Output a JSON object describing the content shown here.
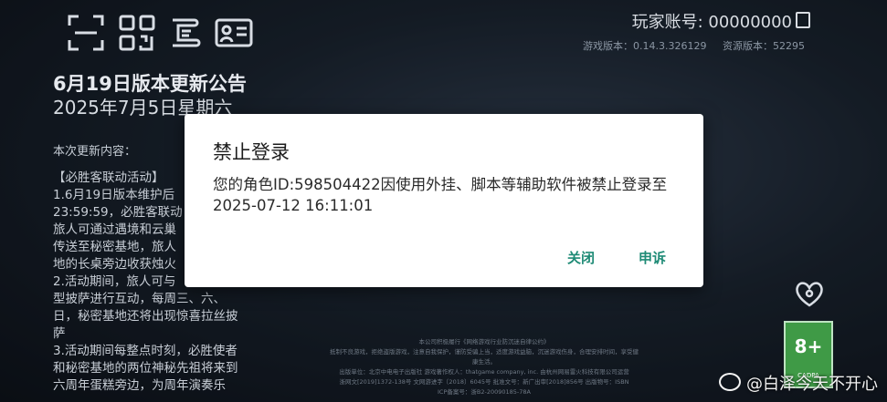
{
  "account": {
    "label": "玩家账号: 00000000"
  },
  "versions": {
    "game": "游戏版本：0.14.3.326129",
    "resource": "资源版本：52295"
  },
  "announcement": {
    "title": "6月19日版本更新公告",
    "date": "2025年7月5日星期六",
    "subtitle": "本次更新内容：",
    "lines": [
      "【必胜客联动活动】",
      "1.6月19日版本维护后",
      "23:59:59，必胜客联动",
      "旅人可通过遇境和云巢",
      "传送至秘密基地，旅人",
      "地的长桌旁边收获烛火",
      "2.活动期间，旅人可与",
      "型披萨进行互动，每周三、六、",
      "日，秘密基地还将出现惊喜拉丝披",
      "萨",
      "3.活动期间每整点时刻，必胜使者",
      "和秘密基地的两位神秘先祖将来到",
      "六周年蛋糕旁边，为周年演奏乐"
    ]
  },
  "footer": {
    "lines": [
      "本公司积极履行《网络游戏行业防沉迷自律公约》",
      "抵制不良游戏，拒绝盗版游戏，注意自我保护，谨防受骗上当，适度游戏益脑，沉迷游戏伤身，合理安排时间，享受健康生活。",
      "出版单位：北京中电电子出版社  游戏著作权人：thatgame company, inc.  由杭州网易雷火科技有限公司运营",
      "浙网文[2019]1372-138号  文网游进字〔2018〕6045号  批准文号：新广出审[2018]856号  出版物号：ISBN",
      "ICP备案号：浙B2-20090185-78A"
    ]
  },
  "rating": {
    "age": "8+",
    "label": "CADPA"
  },
  "watermark": {
    "text": "@白泽今天不开心"
  },
  "dialog": {
    "title": "禁止登录",
    "message": "您的角色ID:598504422因使用外挂、脚本等辅助软件被禁止登录至2025-07-12 16:11:01",
    "close_label": "关闭",
    "appeal_label": "申诉"
  }
}
